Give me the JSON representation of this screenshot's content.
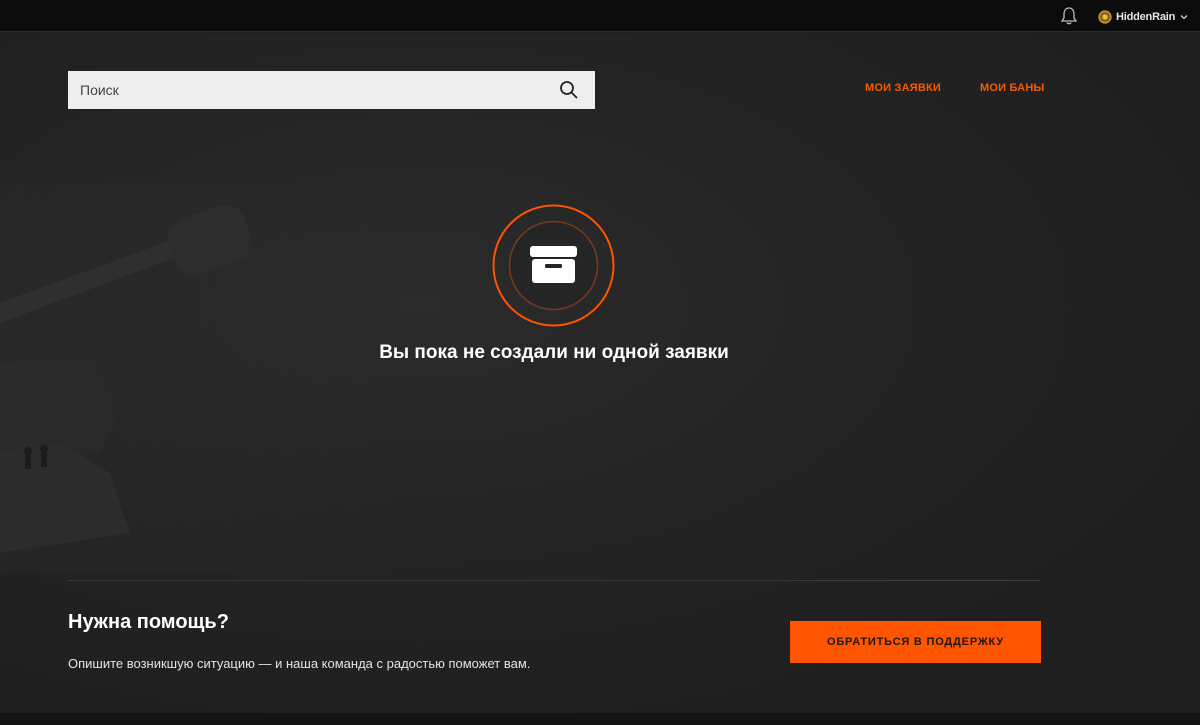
{
  "topbar": {
    "bell_icon": "bell-icon",
    "username": "HiddenRain",
    "user_badge_icon": "clan-badge-icon",
    "dropdown_icon": "chevron-down-icon"
  },
  "search": {
    "placeholder": "Поиск",
    "icon": "search-icon"
  },
  "nav": {
    "my_requests": "МОИ ЗАЯВКИ",
    "my_bans": "МОИ БАНЫ"
  },
  "empty_state": {
    "icon": "archive-box-icon",
    "title": "Вы пока не создали ни одной заявки"
  },
  "help": {
    "title": "Нужна помощь?",
    "text": "Опишите возникшую ситуацию — и наша команда с радостью поможет вам.",
    "button": "ОБРАТИТЬСЯ В ПОДДЕРЖКУ"
  },
  "colors": {
    "accent": "#ff5400",
    "link": "#f25c05",
    "background": "#1f1f1f",
    "topbar": "#0b0b0b"
  }
}
